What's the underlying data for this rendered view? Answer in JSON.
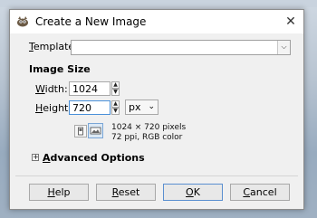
{
  "dialog": {
    "title": "Create a New Image",
    "close_label": "✕"
  },
  "template": {
    "label": "Template:",
    "value": ""
  },
  "image_size": {
    "section_title": "Image Size",
    "width_label": "Width:",
    "width_value": "1024",
    "height_label": "Height:",
    "height_value": "720",
    "unit": "px",
    "info_line1": "1024 × 720 pixels",
    "info_line2": "72 ppi, RGB color"
  },
  "advanced": {
    "label": "Advanced Options"
  },
  "buttons": {
    "help": "Help",
    "reset": "Reset",
    "ok": "OK",
    "cancel": "Cancel"
  },
  "colors": {
    "dialog_bg": "#f0f0f0",
    "focus_accent": "#4a90d9"
  },
  "icons": {
    "app": "gimp-app-icon",
    "close": "close-icon",
    "portrait": "portrait-orientation-icon",
    "landscape": "landscape-orientation-icon",
    "expander": "expander-plus-icon",
    "combo_arrow": "chevron-down-icon"
  }
}
